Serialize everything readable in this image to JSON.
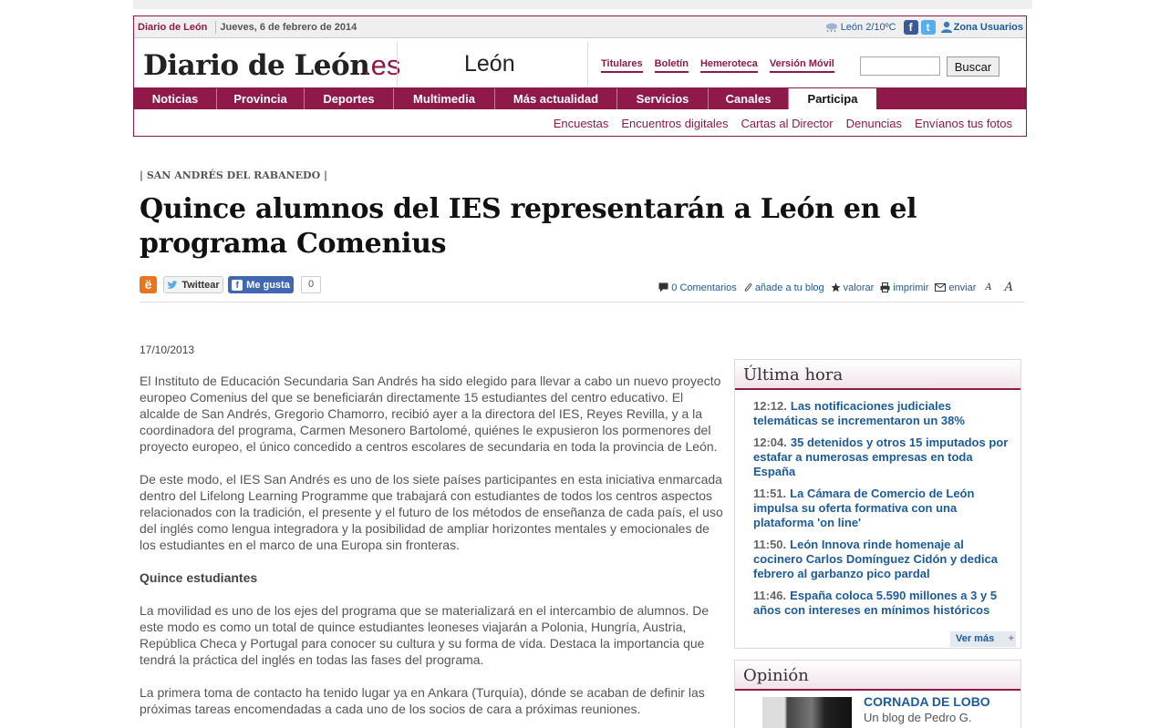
{
  "header": {
    "brand_small": "Diario de León",
    "date": "Jueves, 6 de febrero de 2014",
    "weather": "León 2/10ºC",
    "zona_usuarios": "Zona Usuarios",
    "logo": "Diario de León",
    "logo_suffix": ".es",
    "city": "León",
    "top_links": [
      "Titulares",
      "Boletín",
      "Hemeroteca",
      "Versión Móvil"
    ],
    "search_button": "Buscar",
    "search_value": ""
  },
  "nav": {
    "tabs": [
      "Noticias",
      "Provincia",
      "Deportes",
      "Multimedia",
      "Más actualidad",
      "Servicios",
      "Canales",
      "Participa"
    ],
    "active": "Participa",
    "sub_items": [
      "Encuestas",
      "Encuentros digitales",
      "Cartas al Director",
      "Denuncias",
      "Envíanos tus fotos"
    ]
  },
  "article": {
    "kicker": "| SAN ANDRÉS DEL RABANEDO |",
    "headline": "Quince alumnos del IES representarán a León en el programa Comenius",
    "twitter_label": "Twittear",
    "facebook_label": "Me gusta",
    "facebook_count": "0",
    "tools": {
      "comments": "0 Comentarios",
      "blog": "añade a tu blog",
      "rate": "valorar",
      "print": "imprimir",
      "send": "enviar",
      "font_small": "A",
      "font_large": "A"
    },
    "date": "17/10/2013",
    "paragraphs": [
      "El Instituto de Educación Secundaria San Andrés ha sido elegido para llevar a cabo un nuevo proyecto europeo Comenius del que se beneficiarán directamente 15 estudiantes del centro educativo. El alcalde de San Andrés, Gregorio Chamorro, recibió ayer a la directora del IES, Reyes Revilla, y a la coordinadora del programa, Carmen Mesonero Bartolomé, quiénes le expusieron los pormenores del proyecto europeo, el único concedido a centros escolares de secundaria en toda la provincia de León.",
      "De este modo, el IES San Andrés es uno de los siete países participantes en esta iniciativa enmarcada dentro del Lifelong Learning Programme que trabajará con estudiantes de todos los centros aspectos relacionados con la tradición, el presente y el futuro de los métodos de enseñanza de cada país, el uso del inglés como lengua integradora y la posibilidad de ampliar horizontes mentales y emocionales de los estudiantes en el marco de una Europa sin fronteras."
    ],
    "subheading": "Quince estudiantes",
    "paragraphs_2": [
      "La movilidad es uno de los ejes del programa que se materializará en el intercambio de alumnos. De este modo es como un total de quince estudiantes leoneses viajarán a Polonia, Hungría, Austria, República Checa y Portugal para conocer su cultura y su forma de vida. Destaca la importancia que tendrá la práctica del inglés en todas las fases del programa.",
      "La primera toma de contacto ha tenido lugar ya en Ankara (Turquía), dónde se acaban de definir las próximas tareas encomendadas a cada uno de los socios de cara a próximas reuniones."
    ]
  },
  "ultima_hora": {
    "title": "Última hora",
    "items": [
      {
        "time": "12:12.",
        "text": "Las notificaciones judiciales telemáticas se incrementaron un 38%"
      },
      {
        "time": "12:04.",
        "text": "35 detenidos y otros 15 imputados por estafar a numerosas empresas en toda España"
      },
      {
        "time": "11:51.",
        "text": "La Cámara de Comercio de León impulsa su oferta formativa con una plataforma 'on line'"
      },
      {
        "time": "11:50.",
        "text": "León Innova rinde homenaje al cocinero Carlos Domínguez Cidón y dedica febrero al garbanzo pico pardal"
      },
      {
        "time": "11:46.",
        "text": "España coloca 5.590 millones a 3 y 5 años con intereses en mínimos históricos"
      }
    ],
    "ver_mas": "Ver más",
    "plus": "+"
  },
  "opinion": {
    "title": "Opinión",
    "column_title": "CORNADA DE LOBO",
    "column_sub": "Un blog de Pedro G."
  },
  "colors": {
    "brand": "#8f1a4a",
    "link": "#1c5b9b"
  }
}
